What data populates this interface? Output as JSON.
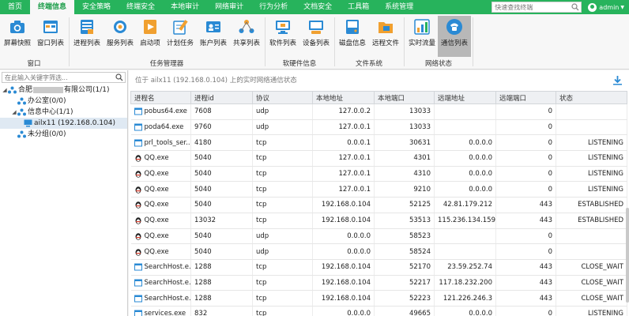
{
  "topnav": {
    "tabs": [
      "首页",
      "终端信息",
      "安全策略",
      "终端安全",
      "本地审计",
      "网络审计",
      "行为分析",
      "文档安全",
      "工具箱",
      "系统管理"
    ],
    "active_index": 1,
    "search_placeholder": "快速查找终端",
    "user": "admin"
  },
  "ribbon": {
    "buttons": [
      {
        "label": "屏幕快照",
        "icon": "camera-icon"
      },
      {
        "label": "窗口列表",
        "icon": "window-list-icon"
      },
      {
        "label": "进程列表",
        "icon": "process-list-icon"
      },
      {
        "label": "服务列表",
        "icon": "service-list-icon"
      },
      {
        "label": "启动项",
        "icon": "startup-icon"
      },
      {
        "label": "计划任务",
        "icon": "scheduled-task-icon"
      },
      {
        "label": "账户列表",
        "icon": "account-list-icon"
      },
      {
        "label": "共享列表",
        "icon": "share-list-icon"
      },
      {
        "label": "软件列表",
        "icon": "software-list-icon"
      },
      {
        "label": "设备列表",
        "icon": "device-list-icon"
      },
      {
        "label": "磁盘信息",
        "icon": "disk-info-icon"
      },
      {
        "label": "远程文件",
        "icon": "remote-file-icon"
      },
      {
        "label": "实时流量",
        "icon": "traffic-chart-icon"
      },
      {
        "label": "通信列表",
        "icon": "phone-icon"
      }
    ],
    "groups": [
      "窗口",
      "任务管理器",
      "软硬件信息",
      "文件系统",
      "网络状态"
    ]
  },
  "tree": {
    "search_placeholder": "在此输入关键字筛选...",
    "root": {
      "prefix": "合肥",
      "suffix": "有限公司(1/1)"
    },
    "office": "办公室(0/0)",
    "info_center": "信息中心(1/1)",
    "terminal": "ailx11 (192.168.0.104)",
    "ungrouped": "未分组(0/0)"
  },
  "main": {
    "breadcrumb": "位于 ailx11 (192.168.0.104) 上的实时网络通信状态",
    "columns": [
      "进程名",
      "进程id",
      "协议",
      "本地地址",
      "本地端口",
      "远端地址",
      "远端端口",
      "状态"
    ],
    "rows": [
      {
        "name": "pobus64.exe",
        "icon": "exe",
        "pid": "7608",
        "proto": "udp",
        "laddr": "127.0.0.2",
        "lport": "13033",
        "raddr": "",
        "rport": "0",
        "state": ""
      },
      {
        "name": "poda64.exe",
        "icon": "exe",
        "pid": "9760",
        "proto": "udp",
        "laddr": "127.0.0.1",
        "lport": "13033",
        "raddr": "",
        "rport": "0",
        "state": ""
      },
      {
        "name": "prl_tools_ser...",
        "icon": "exe",
        "pid": "4180",
        "proto": "tcp",
        "laddr": "0.0.0.1",
        "lport": "30631",
        "raddr": "0.0.0.0",
        "rport": "0",
        "state": "LISTENING"
      },
      {
        "name": "QQ.exe",
        "icon": "qq",
        "pid": "5040",
        "proto": "tcp",
        "laddr": "127.0.0.1",
        "lport": "4301",
        "raddr": "0.0.0.0",
        "rport": "0",
        "state": "LISTENING"
      },
      {
        "name": "QQ.exe",
        "icon": "qq",
        "pid": "5040",
        "proto": "tcp",
        "laddr": "127.0.0.1",
        "lport": "4310",
        "raddr": "0.0.0.0",
        "rport": "0",
        "state": "LISTENING"
      },
      {
        "name": "QQ.exe",
        "icon": "qq",
        "pid": "5040",
        "proto": "tcp",
        "laddr": "127.0.0.1",
        "lport": "9210",
        "raddr": "0.0.0.0",
        "rport": "0",
        "state": "LISTENING"
      },
      {
        "name": "QQ.exe",
        "icon": "qq",
        "pid": "5040",
        "proto": "tcp",
        "laddr": "192.168.0.104",
        "lport": "52125",
        "raddr": "42.81.179.212",
        "rport": "443",
        "state": "ESTABLISHED"
      },
      {
        "name": "QQ.exe",
        "icon": "qq",
        "pid": "13032",
        "proto": "tcp",
        "laddr": "192.168.0.104",
        "lport": "53513",
        "raddr": "115.236.134.159",
        "rport": "443",
        "state": "ESTABLISHED"
      },
      {
        "name": "QQ.exe",
        "icon": "qq",
        "pid": "5040",
        "proto": "udp",
        "laddr": "0.0.0.0",
        "lport": "58523",
        "raddr": "",
        "rport": "0",
        "state": ""
      },
      {
        "name": "QQ.exe",
        "icon": "qq",
        "pid": "5040",
        "proto": "udp",
        "laddr": "0.0.0.0",
        "lport": "58524",
        "raddr": "",
        "rport": "0",
        "state": ""
      },
      {
        "name": "SearchHost.e...",
        "icon": "exe",
        "pid": "1288",
        "proto": "tcp",
        "laddr": "192.168.0.104",
        "lport": "52170",
        "raddr": "23.59.252.74",
        "rport": "443",
        "state": "CLOSE_WAIT"
      },
      {
        "name": "SearchHost.e...",
        "icon": "exe",
        "pid": "1288",
        "proto": "tcp",
        "laddr": "192.168.0.104",
        "lport": "52217",
        "raddr": "117.18.232.200",
        "rport": "443",
        "state": "CLOSE_WAIT"
      },
      {
        "name": "SearchHost.e...",
        "icon": "exe",
        "pid": "1288",
        "proto": "tcp",
        "laddr": "192.168.0.104",
        "lport": "52223",
        "raddr": "121.226.246.3",
        "rport": "443",
        "state": "CLOSE_WAIT"
      },
      {
        "name": "services.exe",
        "icon": "exe",
        "pid": "832",
        "proto": "tcp",
        "laddr": "0.0.0.0",
        "lport": "49665",
        "raddr": "0.0.0.0",
        "rport": "0",
        "state": "LISTENING"
      }
    ]
  },
  "colors": {
    "nav_green": "#27b35c",
    "active_ribbon": "#b8b8b8"
  }
}
